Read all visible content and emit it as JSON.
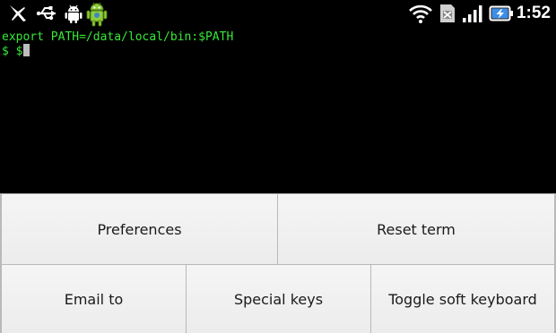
{
  "status_bar": {
    "left_icons": [
      "pin-icon",
      "usb-icon",
      "android-debug-icon",
      "android-robot-icon"
    ],
    "right_icons": [
      "wifi-icon",
      "no-signal-icon",
      "signal-bars-icon",
      "battery-charging-icon"
    ],
    "time": "1:52"
  },
  "terminal": {
    "lines": [
      "export PATH=/data/local/bin:$PATH",
      "$ $"
    ],
    "text_color": "#36e836"
  },
  "menu": {
    "items": [
      "Preferences",
      "Reset term",
      "Email to",
      "Special keys",
      "Toggle soft keyboard"
    ]
  }
}
